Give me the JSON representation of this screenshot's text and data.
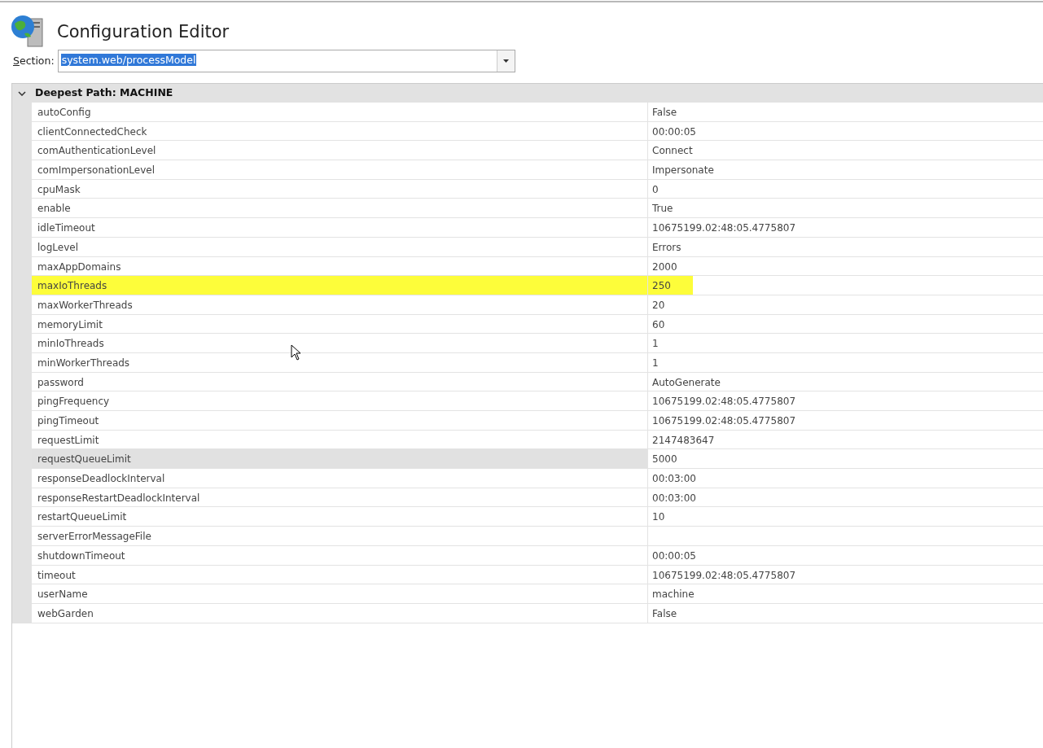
{
  "title": "Configuration Editor",
  "section": {
    "label_mnemonic": "S",
    "label_rest": "ection:",
    "value": "system.web/processModel",
    "value_selected": true
  },
  "group": {
    "title": "Deepest Path: MACHINE",
    "expanded": true
  },
  "rows": [
    {
      "name": "autoConfig",
      "value": "False",
      "selected": false,
      "highlighted": false
    },
    {
      "name": "clientConnectedCheck",
      "value": "00:00:05",
      "selected": false,
      "highlighted": false
    },
    {
      "name": "comAuthenticationLevel",
      "value": "Connect",
      "selected": false,
      "highlighted": false
    },
    {
      "name": "comImpersonationLevel",
      "value": "Impersonate",
      "selected": false,
      "highlighted": false
    },
    {
      "name": "cpuMask",
      "value": "0",
      "selected": false,
      "highlighted": false
    },
    {
      "name": "enable",
      "value": "True",
      "selected": false,
      "highlighted": false
    },
    {
      "name": "idleTimeout",
      "value": "10675199.02:48:05.4775807",
      "selected": false,
      "highlighted": false
    },
    {
      "name": "logLevel",
      "value": "Errors",
      "selected": false,
      "highlighted": false
    },
    {
      "name": "maxAppDomains",
      "value": "2000",
      "selected": false,
      "highlighted": false
    },
    {
      "name": "maxIoThreads",
      "value": "250",
      "selected": false,
      "highlighted": true
    },
    {
      "name": "maxWorkerThreads",
      "value": "20",
      "selected": false,
      "highlighted": false
    },
    {
      "name": "memoryLimit",
      "value": "60",
      "selected": false,
      "highlighted": false
    },
    {
      "name": "minIoThreads",
      "value": "1",
      "selected": false,
      "highlighted": false
    },
    {
      "name": "minWorkerThreads",
      "value": "1",
      "selected": false,
      "highlighted": false
    },
    {
      "name": "password",
      "value": "AutoGenerate",
      "selected": false,
      "highlighted": false
    },
    {
      "name": "pingFrequency",
      "value": "10675199.02:48:05.4775807",
      "selected": false,
      "highlighted": false
    },
    {
      "name": "pingTimeout",
      "value": "10675199.02:48:05.4775807",
      "selected": false,
      "highlighted": false
    },
    {
      "name": "requestLimit",
      "value": "2147483647",
      "selected": false,
      "highlighted": false
    },
    {
      "name": "requestQueueLimit",
      "value": "5000",
      "selected": true,
      "highlighted": false
    },
    {
      "name": "responseDeadlockInterval",
      "value": "00:03:00",
      "selected": false,
      "highlighted": false
    },
    {
      "name": "responseRestartDeadlockInterval",
      "value": "00:03:00",
      "selected": false,
      "highlighted": false
    },
    {
      "name": "restartQueueLimit",
      "value": "10",
      "selected": false,
      "highlighted": false
    },
    {
      "name": "serverErrorMessageFile",
      "selected": false,
      "highlighted": false
    },
    {
      "name": "shutdownTimeout",
      "value": "00:00:05",
      "selected": false,
      "highlighted": false
    },
    {
      "name": "timeout",
      "value": "10675199.02:48:05.4775807",
      "selected": false,
      "highlighted": false
    },
    {
      "name": "userName",
      "value": "machine",
      "selected": false,
      "highlighted": false
    },
    {
      "name": "webGarden",
      "value": "False",
      "selected": false,
      "highlighted": false
    }
  ]
}
